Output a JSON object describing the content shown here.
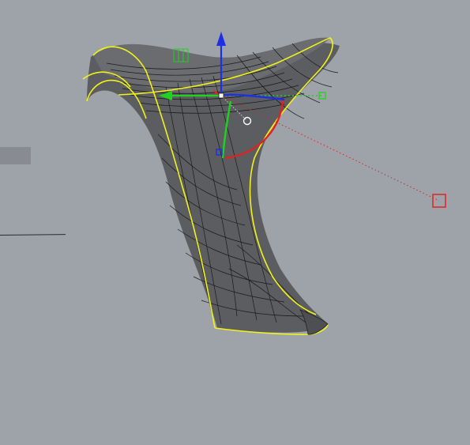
{
  "viewport": {
    "background": "#9ea3a9",
    "surface_fill": "#5b5d60",
    "surface_iso": "#1a1a1a",
    "edge_highlight": "#f2f21a"
  },
  "gizmo": {
    "x_axis_color": "#1fd21f",
    "y_axis_color": "#1f2fe6",
    "z_axis_color": "#1f2fe6",
    "rotate_red_color": "#e12222",
    "scale_handle_color": "#e12222",
    "icons": [
      "move-arrow-icon",
      "rotate-arc-icon",
      "scale-handle-icon",
      "plane-handle-icon"
    ]
  }
}
